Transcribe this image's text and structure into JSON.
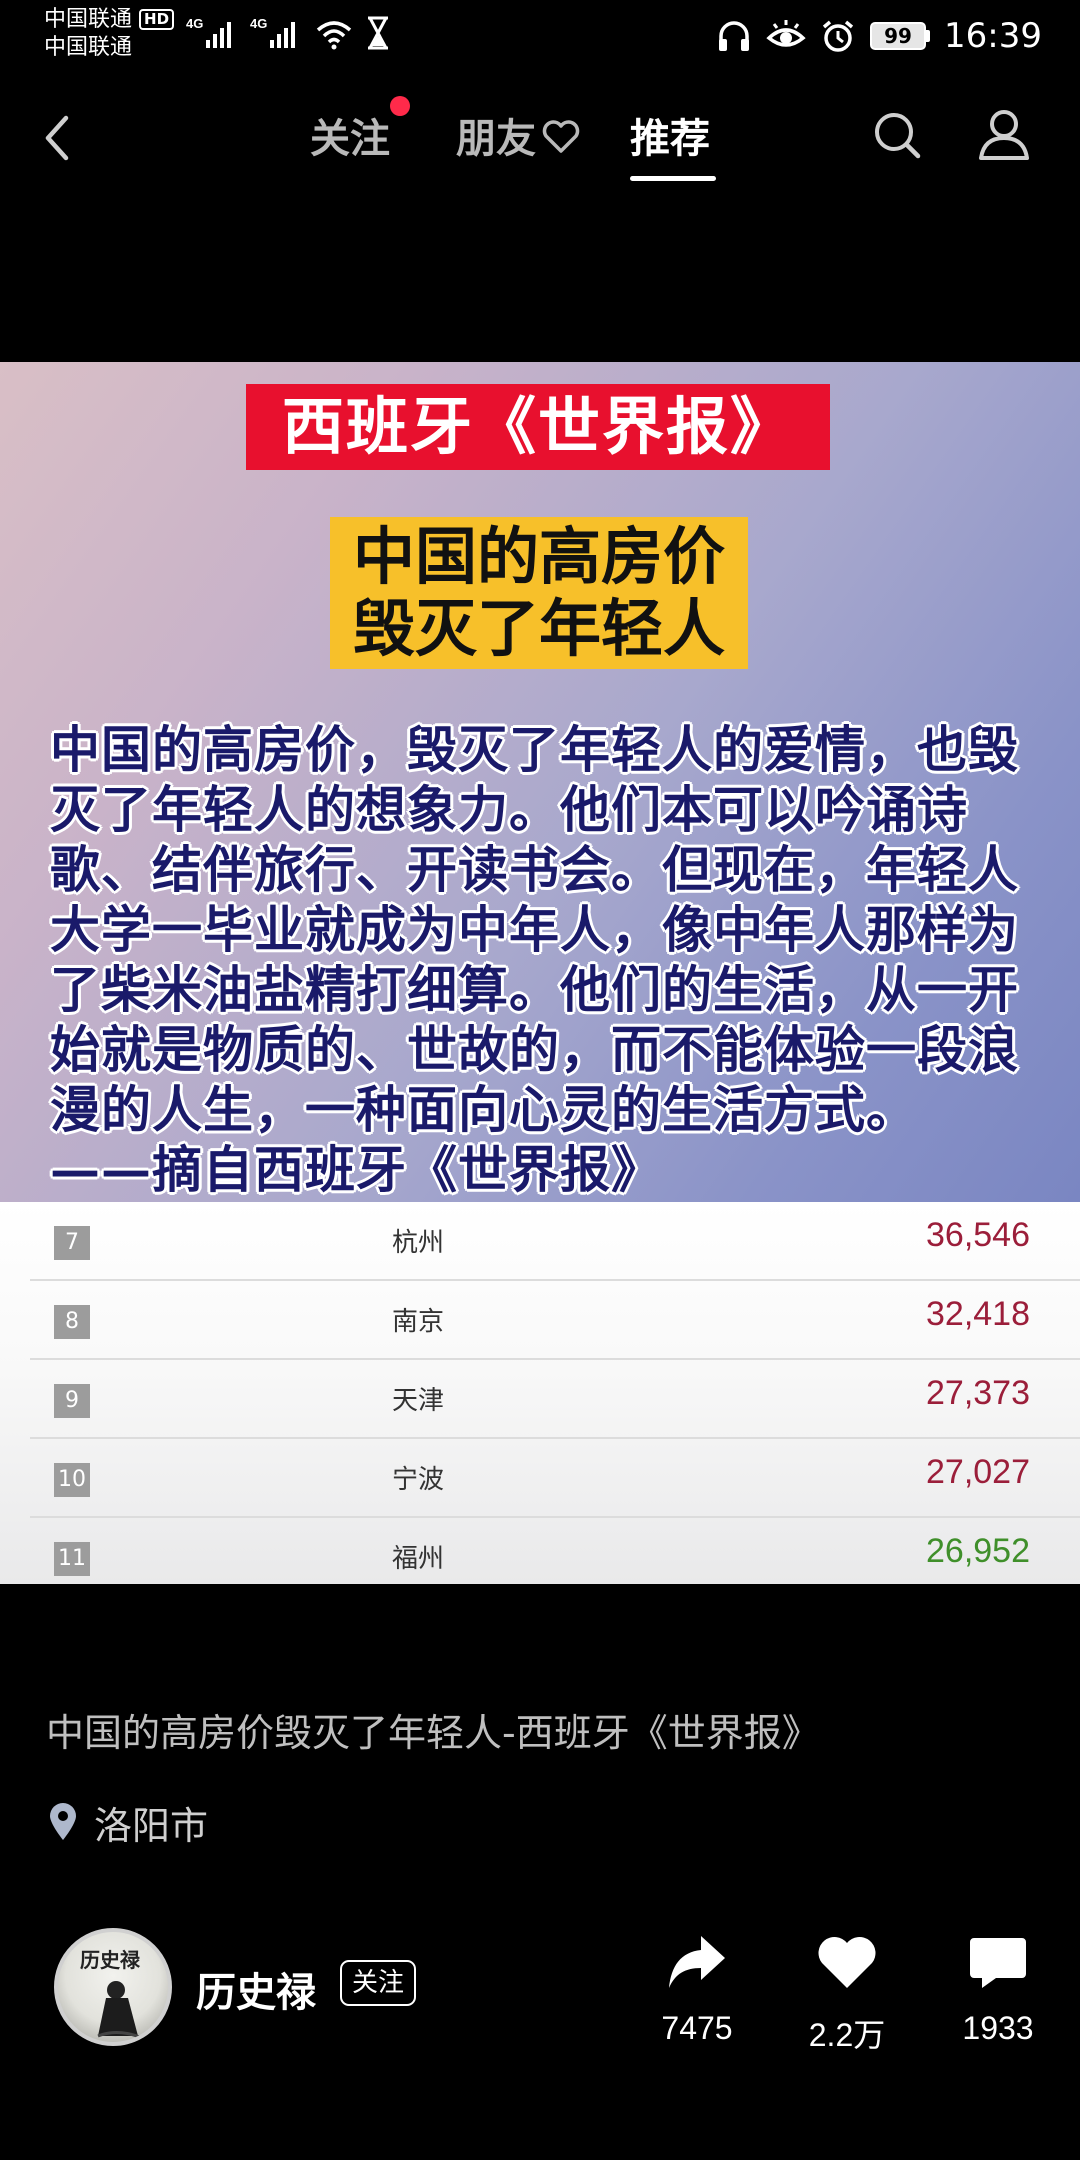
{
  "status_bar": {
    "carrier_1": "中国联通",
    "hd_badge": "HD",
    "carrier_2": "中国联通",
    "network_1": "4G",
    "network_2": "4G",
    "battery": "99",
    "time": "16:39"
  },
  "nav": {
    "tabs": [
      {
        "label": "关注"
      },
      {
        "label": "朋友"
      },
      {
        "label": "推荐"
      }
    ],
    "active_tab": "推荐"
  },
  "post_image": {
    "title": "西班牙《世界报》",
    "headline_line1": "中国的高房价",
    "headline_line2": "毁灭了年轻人",
    "body": "中国的高房价，毁灭了年轻人的爱情，也毁灭了年轻人的想象力。他们本可以吟诵诗歌、结伴旅行、开读书会。但现在，年轻人大学一毕业就成为中年人，像中年人那样为了柴米油盐精打细算。他们的生活，从一开始就是物质的、世故的，而不能体验一段浪漫的人生，一种面向心灵的生活方式。　　——摘自西班牙《世界报》",
    "rank_rows": [
      {
        "rank": "7",
        "city": "杭州",
        "value": "36,546",
        "color": "#9b1e3a"
      },
      {
        "rank": "8",
        "city": "南京",
        "value": "32,418",
        "color": "#9b1e3a"
      },
      {
        "rank": "9",
        "city": "天津",
        "value": "27,373",
        "color": "#9b1e3a"
      },
      {
        "rank": "10",
        "city": "宁波",
        "value": "27,027",
        "color": "#9b1e3a"
      },
      {
        "rank": "11",
        "city": "福州",
        "value": "26,952",
        "color": "#3f8f2a"
      }
    ]
  },
  "post": {
    "caption": "中国的高房价毁灭了年轻人-西班牙《世界报》",
    "location": "洛阳市"
  },
  "author": {
    "name": "历史禄",
    "avatar_text": "历史禄",
    "follow_label": "关注"
  },
  "actions": {
    "share_count": "7475",
    "like_count": "2.2万",
    "comment_count": "1933"
  },
  "colors": {
    "accent_red": "#e8102e",
    "headline_yellow": "#f7c02a",
    "notification_dot": "#ff2a4a"
  }
}
